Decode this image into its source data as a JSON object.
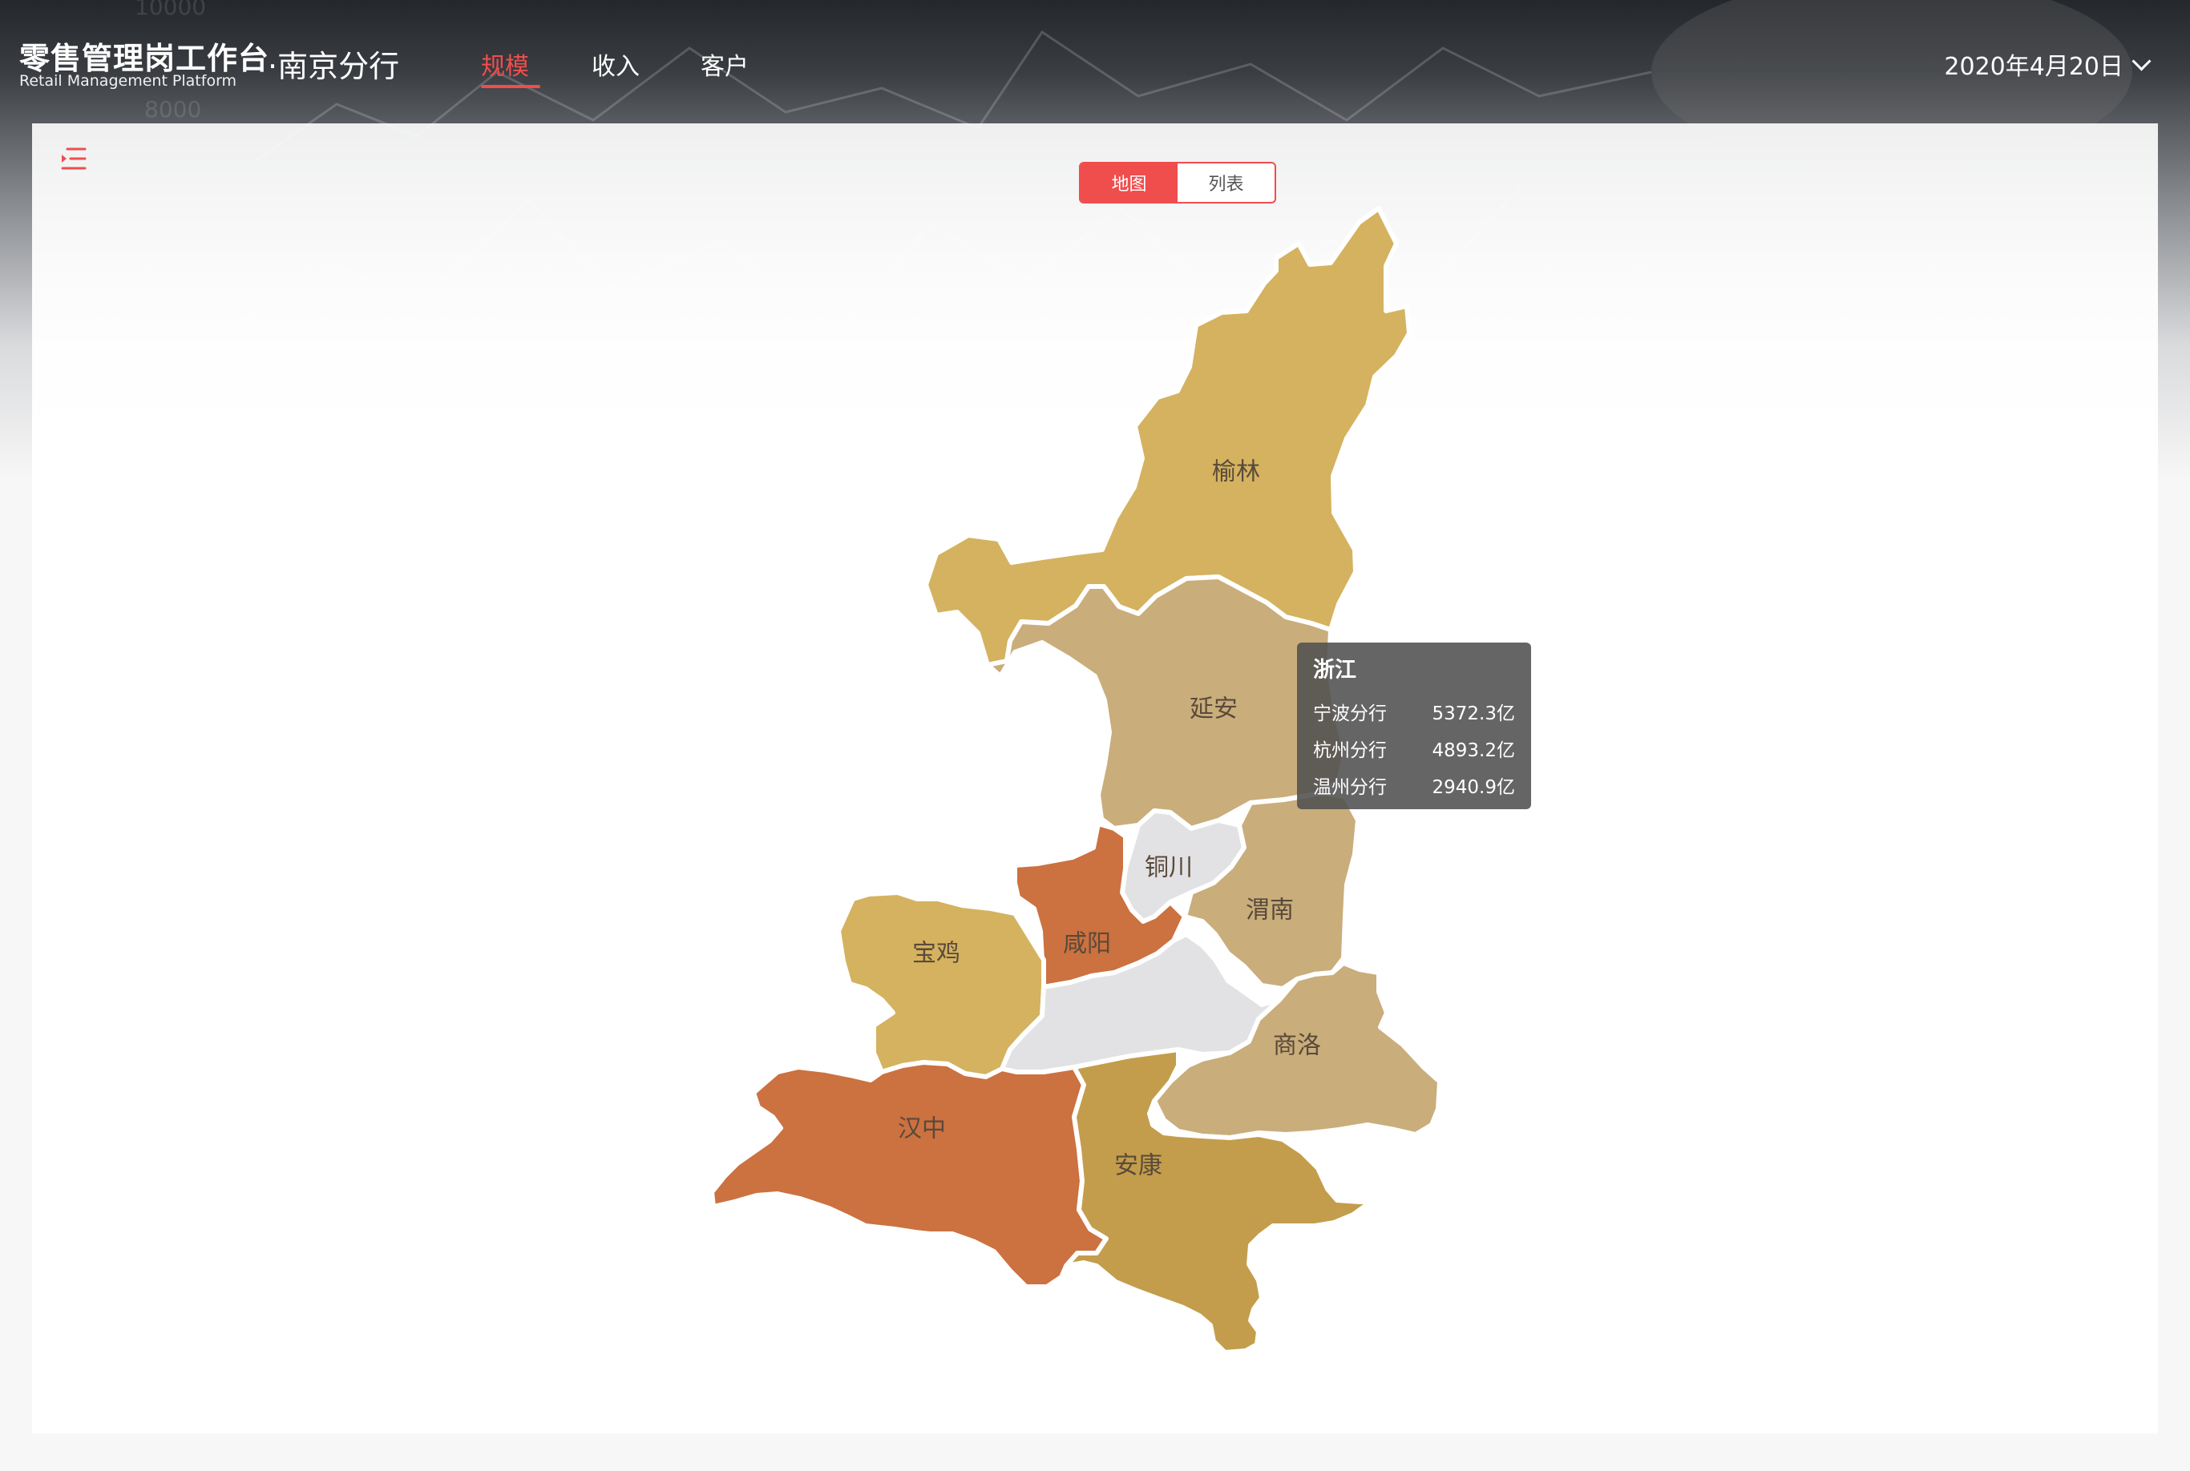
{
  "header": {
    "brand_cn": "零售管理岗工作台",
    "brand_en": "Retail Management Platform",
    "branch": "·南京分行",
    "nav": [
      {
        "label": "规模",
        "active": true
      },
      {
        "label": "收入",
        "active": false
      },
      {
        "label": "客户",
        "active": false
      }
    ],
    "date": "2020年4月20日"
  },
  "view_toggle": {
    "map": "地图",
    "list": "列表",
    "selected": "地图"
  },
  "map": {
    "regions": [
      {
        "name": "榆林",
        "color": "#d4b25f"
      },
      {
        "name": "延安",
        "color": "#c9ad7b"
      },
      {
        "name": "铜川",
        "color": "#e2e2e4"
      },
      {
        "name": "渭南",
        "color": "#c9ad7b"
      },
      {
        "name": "咸阳",
        "color": "#cc7140"
      },
      {
        "name": "宝鸡",
        "color": "#d4b25f"
      },
      {
        "name": "",
        "color": "#e2e2e4"
      },
      {
        "name": "商洛",
        "color": "#c9ad7b"
      },
      {
        "name": "汉中",
        "color": "#cc7140"
      },
      {
        "name": "安康",
        "color": "#c39d4c"
      }
    ]
  },
  "tooltip": {
    "title": "浙江",
    "rows": [
      {
        "label": "宁波分行",
        "value": "5372.3亿"
      },
      {
        "label": "杭州分行",
        "value": "4893.2亿"
      },
      {
        "label": "温州分行",
        "value": "2940.9亿"
      }
    ]
  },
  "colors": {
    "accent": "#f04d4d"
  }
}
